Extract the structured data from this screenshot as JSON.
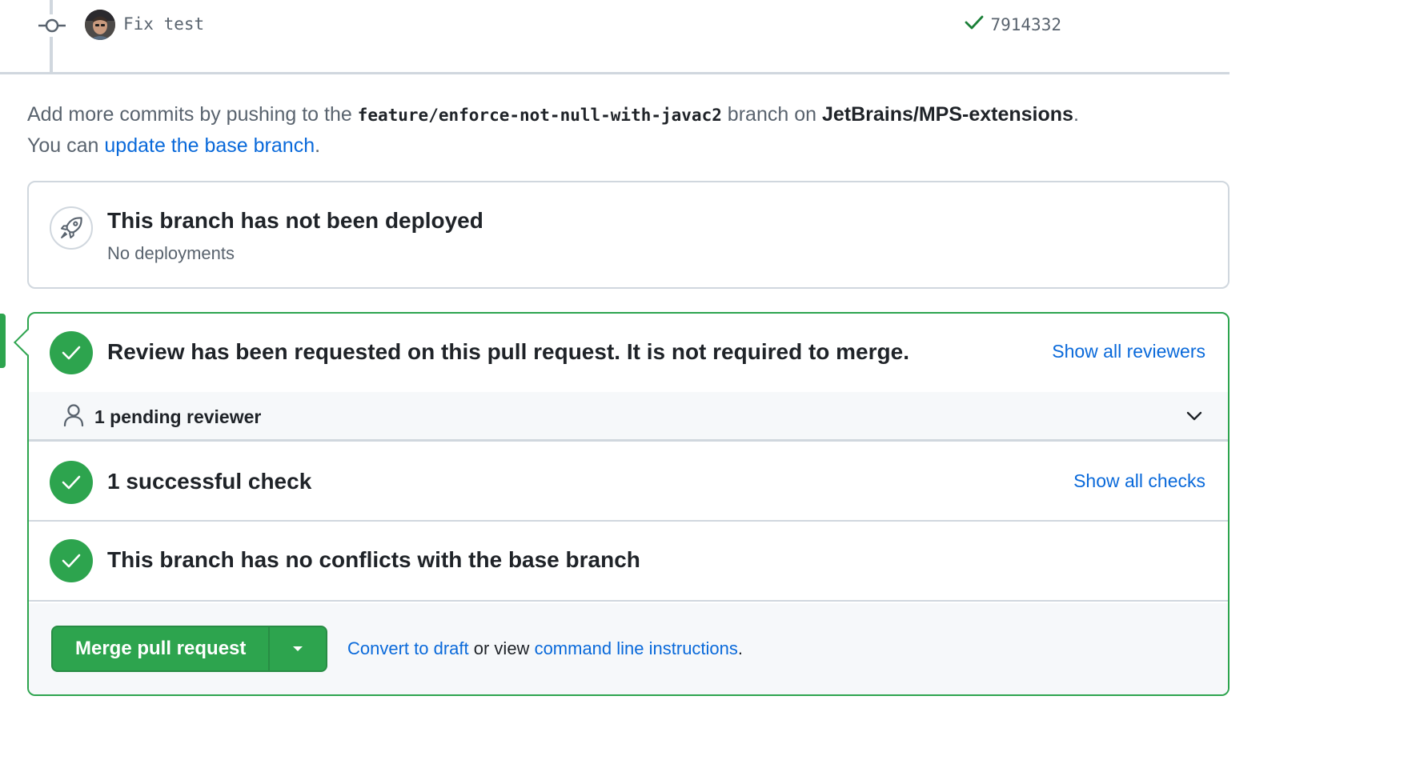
{
  "commit": {
    "title": "Fix test",
    "sha": "7914332",
    "status_color": "#1a7f37",
    "icons": {
      "commit": "git-commit-icon",
      "status": "check-icon"
    }
  },
  "push_info": {
    "line1_prefix": "Add more commits by pushing to the ",
    "branch": "feature/enforce-not-null-with-javac2",
    "line1_middle": " branch on ",
    "repo": "JetBrains/MPS-extensions",
    "line1_suffix": ".",
    "line2_prefix": "You can ",
    "update_link": "update the base branch",
    "line2_suffix": "."
  },
  "deployment": {
    "icon": "rocket-icon",
    "title": "This branch has not been deployed",
    "subtitle": "No deployments"
  },
  "merge_box": {
    "accent_color": "#2da44e",
    "review": {
      "icon": "check-circle-icon",
      "title": "Review has been requested on this pull request. It is not required to merge.",
      "link": "Show all reviewers"
    },
    "pending": {
      "icon": "person-icon",
      "label": "1 pending reviewer",
      "toggle_icon": "chevron-down-icon"
    },
    "checks": {
      "icon": "check-circle-icon",
      "title": "1 successful check",
      "link": "Show all checks"
    },
    "conflicts": {
      "icon": "check-circle-icon",
      "title": "This branch has no conflicts with the base branch"
    },
    "actions": {
      "merge_button": "Merge pull request",
      "dropdown_icon": "caret-down-icon",
      "draft_link": "Convert to draft",
      "or_view": " or view ",
      "cli_link": "command line instructions",
      "suffix": "."
    }
  }
}
